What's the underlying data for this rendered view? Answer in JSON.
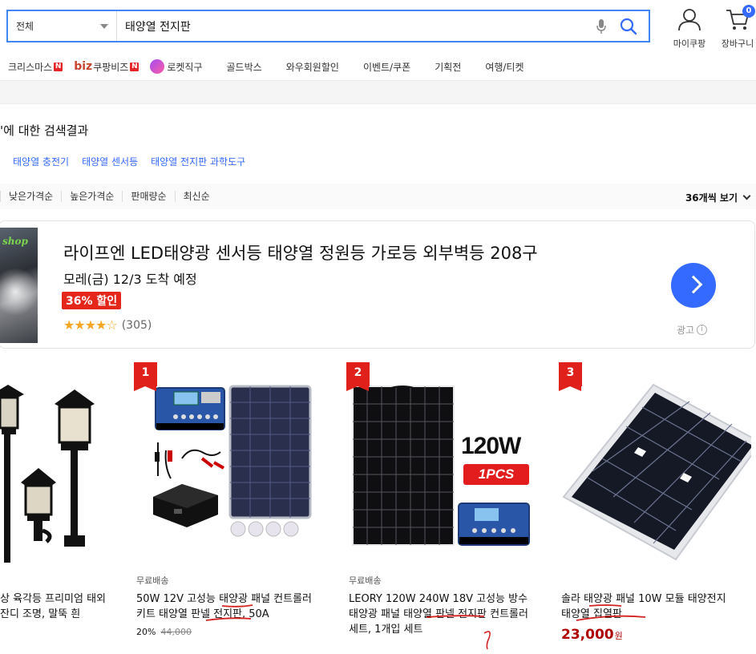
{
  "search": {
    "category": "전체",
    "query": "태양열 전지판"
  },
  "header": {
    "my_coupang": "마이쿠팡",
    "cart": "장바구니",
    "cart_count": "0"
  },
  "nav": {
    "items": [
      {
        "label": "크리스마스",
        "badge": "N"
      },
      {
        "biz": "biz",
        "label": "쿠팡비즈",
        "badge": "N"
      },
      {
        "label": "로켓직구"
      },
      {
        "label": "골드박스"
      },
      {
        "label": "와우회원할인"
      },
      {
        "label": "이벤트/쿠폰"
      },
      {
        "label": "기획전"
      },
      {
        "label": "여행/티켓"
      }
    ]
  },
  "results": {
    "title": "'에 대한 검색결과",
    "related": [
      "태양열 충전기",
      "태양열 센서등",
      "태양열 전지판 과학도구"
    ]
  },
  "sort": {
    "options": [
      "낮은가격순",
      "높은가격순",
      "판매량순",
      "최신순"
    ],
    "per_page": "36개씩 보기"
  },
  "ad": {
    "image_text": "shop",
    "title": "라이프엔 LED태양광 센서등 태양열 정원등 가로등 외부벽등 208구",
    "delivery": "모레(금) 12/3 도착 예정",
    "discount": "36% 할인",
    "stars": "★★★★☆",
    "rating_count": "(305)",
    "label": "광고",
    "info_glyph": "i"
  },
  "products": [
    {
      "name": "상 육각등 프리미엄 태외 잔디 조명, 말뚝 흰",
      "free_shipping": "",
      "price": ""
    },
    {
      "rank": "1",
      "free_shipping": "무료배송",
      "name": "50W 12V 고성능 태양광 패널 컨트롤러 키트 태양열 판넬 전지판, 50A",
      "discount": "20%",
      "original_price": "44,000"
    },
    {
      "rank": "2",
      "free_shipping": "무료배송",
      "name": "LEORY 120W 240W 18V 고성능 방수 태양광 패널 태양열 판넬 전지판 컨트롤러 세트, 1개입 세트",
      "badge_power": "120W",
      "badge_pcs": "1PCS"
    },
    {
      "rank": "3",
      "name": "솔라 태양광 패널 10W 모듈 태양전지 태양열 집열판",
      "price": "23,000",
      "currency": "원"
    }
  ]
}
